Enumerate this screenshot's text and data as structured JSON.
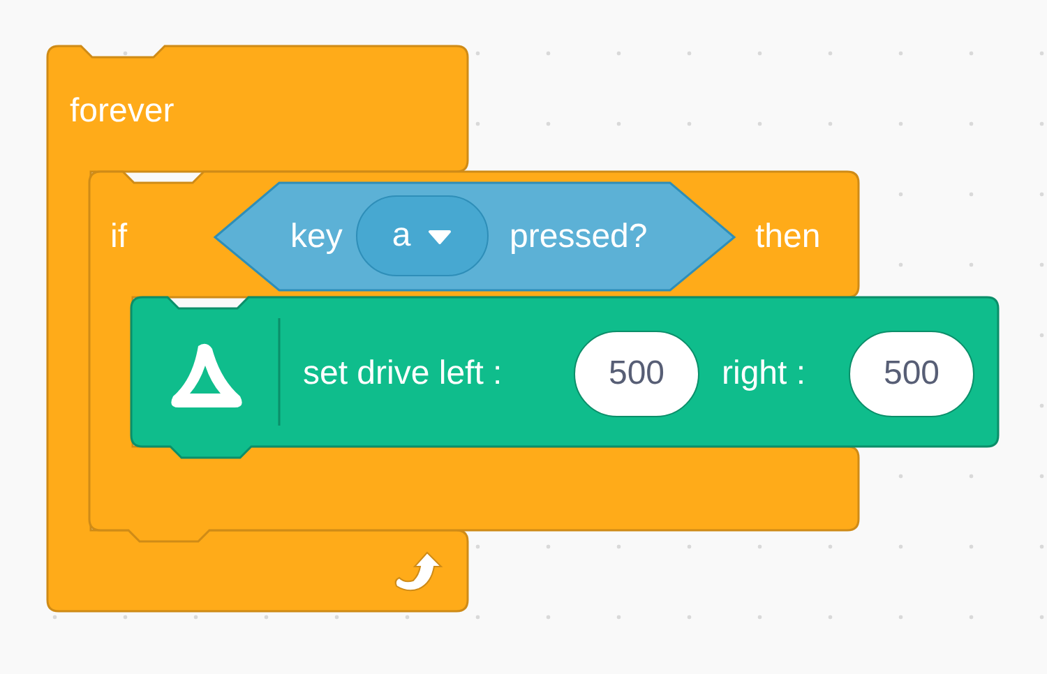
{
  "forever_block": {
    "label": "forever"
  },
  "if_block": {
    "label_if": "if",
    "label_then": "then",
    "condition": {
      "label_before": "key",
      "dropdown_value": "a",
      "label_after": "pressed?"
    }
  },
  "drive_block": {
    "label_left": "set drive left :",
    "left_value": "500",
    "label_right": "right :",
    "right_value": "500"
  }
}
